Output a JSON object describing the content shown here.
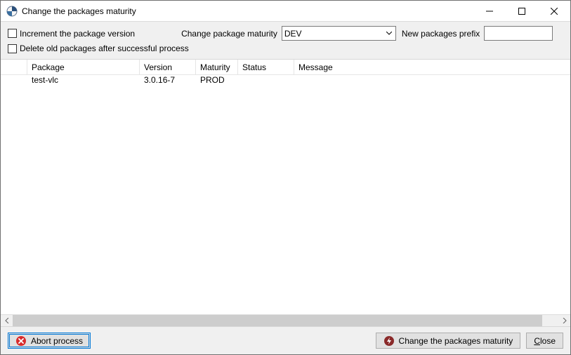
{
  "window": {
    "title": "Change the packages maturity"
  },
  "options": {
    "increment_label": "Increment the package version",
    "increment_checked": false,
    "delete_label": "Delete old packages after successful process",
    "delete_checked": false,
    "maturity_label": "Change package maturity",
    "maturity_value": "DEV",
    "prefix_label": "New packages prefix",
    "prefix_value": ""
  },
  "table": {
    "columns": {
      "package": "Package",
      "version": "Version",
      "maturity": "Maturity",
      "status": "Status",
      "message": "Message"
    },
    "rows": [
      {
        "package": "test-vlc",
        "version": "3.0.16-7",
        "maturity": "PROD",
        "status": "",
        "message": ""
      }
    ]
  },
  "buttons": {
    "abort": "Abort process",
    "change": "Change the packages maturity",
    "close": "Close"
  }
}
